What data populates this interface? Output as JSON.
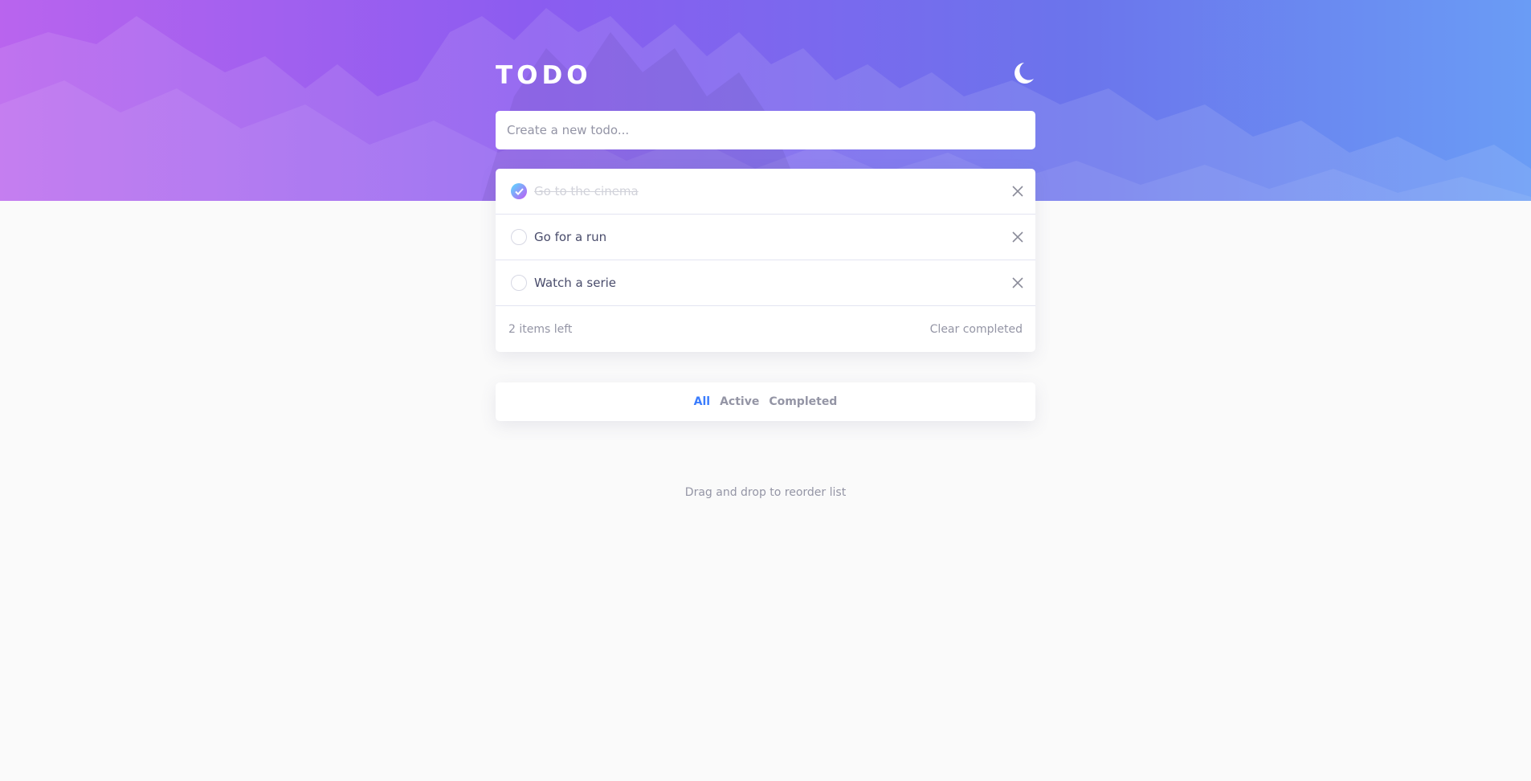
{
  "app": {
    "title": "TODO"
  },
  "theme_toggle": {
    "icon": "moon-icon"
  },
  "new_todo": {
    "placeholder": "Create a new todo..."
  },
  "todos": [
    {
      "text": "Go to the cinema",
      "completed": true
    },
    {
      "text": "Go for a run",
      "completed": false
    },
    {
      "text": "Watch a serie",
      "completed": false
    }
  ],
  "footer": {
    "items_left": "2 items left",
    "clear_completed": "Clear completed"
  },
  "filters": {
    "all": "All",
    "active": "Active",
    "completed": "Completed",
    "selected": "All"
  },
  "hint": "Drag and drop to reorder list",
  "colors": {
    "accent": "#3a7cfd",
    "check_gradient_start": "#57ddff",
    "check_gradient_end": "#c058f3",
    "text": "#494c6b",
    "muted": "#9495a5"
  }
}
